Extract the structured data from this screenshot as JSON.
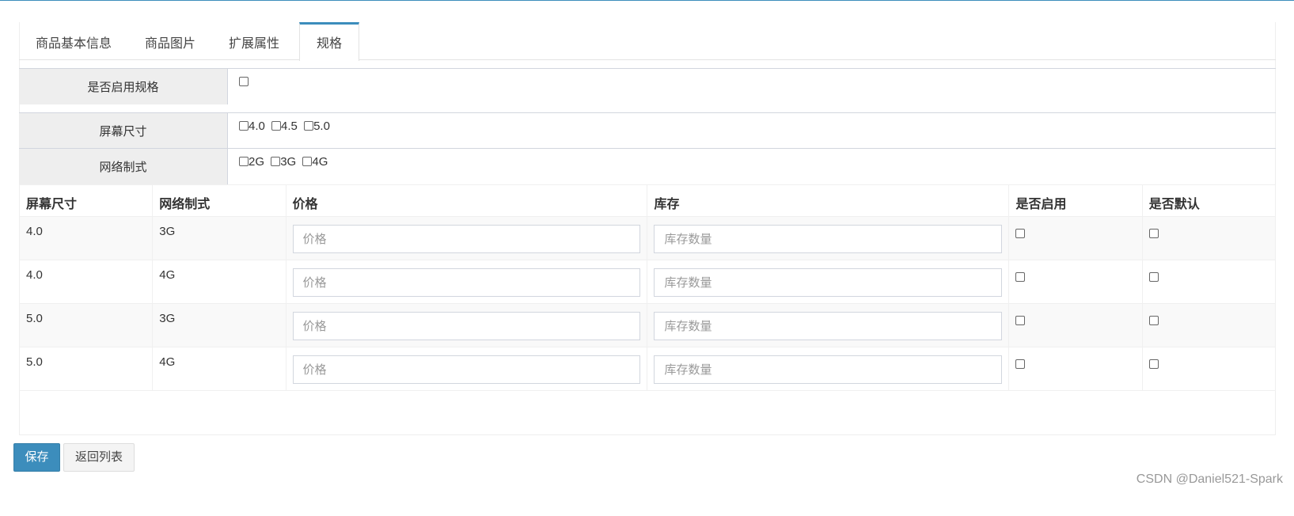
{
  "tabs": [
    {
      "label": "商品基本信息",
      "active": false
    },
    {
      "label": "商品图片",
      "active": false
    },
    {
      "label": "扩展属性",
      "active": false
    },
    {
      "label": "规格",
      "active": true
    }
  ],
  "enable_spec": {
    "label": "是否启用规格",
    "checked": false
  },
  "spec_options": [
    {
      "label": "屏幕尺寸",
      "options": [
        "4.0",
        "4.5",
        "5.0"
      ]
    },
    {
      "label": "网络制式",
      "options": [
        "2G",
        "3G",
        "4G"
      ]
    }
  ],
  "sku_table": {
    "headers": [
      "屏幕尺寸",
      "网络制式",
      "价格",
      "库存",
      "是否启用",
      "是否默认"
    ],
    "price_placeholder": "价格",
    "stock_placeholder": "库存数量",
    "rows": [
      {
        "size": "4.0",
        "network": "3G"
      },
      {
        "size": "4.0",
        "network": "4G"
      },
      {
        "size": "5.0",
        "network": "3G"
      },
      {
        "size": "5.0",
        "network": "4G"
      }
    ]
  },
  "buttons": {
    "save": "保存",
    "back": "返回列表"
  },
  "watermark": "CSDN @Daniel521-Spark",
  "colors": {
    "accent": "#3c8dbc",
    "label_bg": "#eeeeee"
  }
}
